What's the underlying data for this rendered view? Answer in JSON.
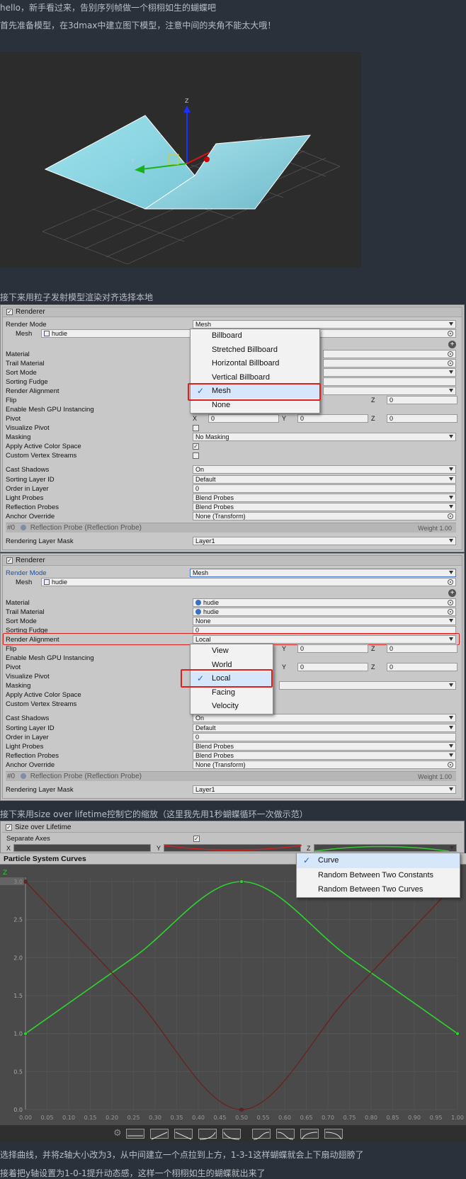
{
  "article": {
    "line1": "hello，新手看过来，告别序列帧做一个栩栩如生的蝴蝶吧",
    "line2": "首先准备模型，在3dmax中建立图下模型，注意中间的夹角不能太大哦！",
    "line3": "接下来用粒子发射模型渲染对齐选择本地",
    "line4": "接下来用size over lifetime控制它的缩放（这里我先用1秒蝴蝶循环一次做示范）",
    "line5": "选择曲线，并将z轴大小改为3，从中间建立一个点拉到上方，1-3-1这样蝴蝶就会上下扇动翅膀了",
    "line6": "接着把y轴设置为1-0-1提升动态感，这样一个栩栩如生的蝴蝶就出来了"
  },
  "viewport": {
    "axis_z": "Z",
    "axis_y": "Y",
    "axis_x": "X"
  },
  "renderer1": {
    "title": "Renderer",
    "labels": [
      "Render Mode",
      "Mesh",
      "Material",
      "Trail Material",
      "Sort Mode",
      "Sorting Fudge",
      "Render Alignment",
      "Flip",
      "Enable Mesh GPU Instancing",
      "Pivot",
      "Visualize Pivot",
      "Masking",
      "Apply Active Color Space",
      "Custom Vertex Streams",
      "Cast Shadows",
      "Sorting Layer ID",
      "Order in Layer",
      "Light Probes",
      "Reflection Probes",
      "Anchor Override"
    ],
    "render_mode": "Mesh",
    "mesh": "hudie",
    "flip_z": "0",
    "pivot_x": "0",
    "pivot_y": "0",
    "pivot_z": "0",
    "masking": "No Masking",
    "cast_shadows": "On",
    "sorting_layer": "Default",
    "order": "0",
    "light_probes": "Blend Probes",
    "reflection_probes": "Blend Probes",
    "anchor": "None (Transform)",
    "probe_index": "#0",
    "probe_name": "Reflection Probe (Reflection Probe)",
    "probe_weight": "Weight 1.00",
    "layer_mask_label": "Rendering Layer Mask",
    "layer_mask": "Layer1",
    "dropdown": [
      "Billboard",
      "Stretched Billboard",
      "Horizontal Billboard",
      "Vertical Billboard",
      "Mesh",
      "None"
    ]
  },
  "renderer2": {
    "title": "Renderer",
    "labels": [
      "Render Mode",
      "Mesh",
      "Material",
      "Trail Material",
      "Sort Mode",
      "Sorting Fudge",
      "Render Alignment",
      "Flip",
      "Enable Mesh GPU Instancing",
      "Pivot",
      "Visualize Pivot",
      "Masking",
      "Apply Active Color Space",
      "Custom Vertex Streams",
      "Cast Shadows",
      "Sorting Layer ID",
      "Order in Layer",
      "Light Probes",
      "Reflection Probes",
      "Anchor Override"
    ],
    "render_mode": "Mesh",
    "mesh": "hudie",
    "material": "hudie",
    "trail_material": "hudie",
    "sort_mode": "None",
    "fudge": "0",
    "alignment": "Local",
    "flip_y": "0",
    "flip_z": "0",
    "pivot_y": "0",
    "pivot_z": "0",
    "cast_shadows": "On",
    "sorting_layer": "Default",
    "order": "0",
    "light_probes": "Blend Probes",
    "reflection_probes": "Blend Probes",
    "anchor": "None (Transform)",
    "probe_index": "#0",
    "probe_name": "Reflection Probe (Reflection Probe)",
    "probe_weight": "Weight 1.00",
    "layer_mask_label": "Rendering Layer Mask",
    "layer_mask": "Layer1",
    "dropdown": [
      "View",
      "World",
      "Local",
      "Facing",
      "Velocity"
    ]
  },
  "sol": {
    "title": "Size over Lifetime",
    "separate_axes": "Separate Axes",
    "ax_x": "X",
    "ax_y": "Y",
    "ax_z": "Z",
    "curves_title": "Particle System Curves",
    "dropdown": [
      "Curve",
      "Random Between Two Constants",
      "Random Between Two Curves"
    ]
  },
  "chart_data": {
    "type": "line",
    "title": "Particle System Curves",
    "xlabel": "",
    "ylabel": "",
    "xlim": [
      0,
      1.0
    ],
    "ylim": [
      0,
      3.0
    ],
    "x_ticks": [
      "0.00",
      "0.05",
      "0.10",
      "0.15",
      "0.20",
      "0.25",
      "0.30",
      "0.35",
      "0.40",
      "0.45",
      "0.50",
      "0.55",
      "0.60",
      "0.65",
      "0.70",
      "0.75",
      "0.80",
      "0.85",
      "0.90",
      "0.95",
      "1.00"
    ],
    "y_ticks": [
      "0.0",
      "0.5",
      "1.0",
      "1.5",
      "2.0",
      "2.5",
      "3.0"
    ],
    "y_axis_letter": "Z",
    "series": [
      {
        "color": "#2ed22e",
        "x": [
          0,
          0.25,
          0.5,
          0.75,
          1.0
        ],
        "values": [
          1.0,
          2.0,
          3.0,
          2.0,
          1.0
        ]
      },
      {
        "color": "#6a2121",
        "x": [
          0,
          0.25,
          0.5,
          0.75,
          1.0
        ],
        "values": [
          3.0,
          1.5,
          0.0,
          1.5,
          3.0
        ]
      }
    ],
    "grid": true,
    "legend": "none"
  }
}
